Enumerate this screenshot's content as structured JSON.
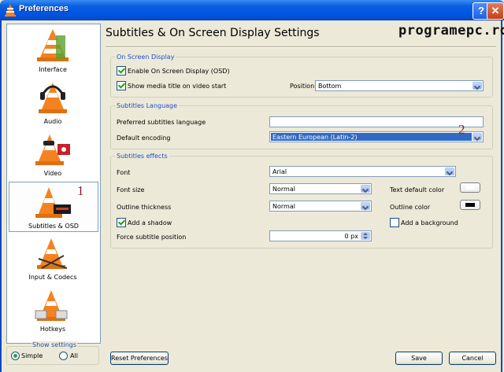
{
  "window": {
    "title": "Preferences",
    "help_glyph": "?",
    "close_glyph": "✕"
  },
  "sidebar": {
    "items": [
      {
        "label": "Interface"
      },
      {
        "label": "Audio"
      },
      {
        "label": "Video"
      },
      {
        "label": "Subtitles & OSD"
      },
      {
        "label": "Input & Codecs"
      },
      {
        "label": "Hotkeys"
      }
    ],
    "annotation": "1"
  },
  "show_settings": {
    "legend": "Show settings",
    "simple": "Simple",
    "all": "All",
    "selected": "Simple"
  },
  "header": {
    "title": "Subtitles & On Screen Display Settings",
    "brand": "programepc.ro"
  },
  "osd": {
    "legend": "On Screen Display",
    "enable_label": "Enable On Screen Display (OSD)",
    "show_title_label": "Show media title on video start",
    "position_label": "Position",
    "position_value": "Bottom"
  },
  "lang": {
    "legend": "Subtitles Language",
    "preferred_label": "Preferred subtitles language",
    "preferred_value": "",
    "encoding_label": "Default encoding",
    "encoding_value": "Eastern European (Latin-2)",
    "annotation": "2"
  },
  "effects": {
    "legend": "Subtitles effects",
    "font_label": "Font",
    "font_value": "Arial",
    "size_label": "Font size",
    "size_value": "Normal",
    "thickness_label": "Outline thickness",
    "thickness_value": "Normal",
    "text_color_label": "Text default color",
    "outline_color_label": "Outline color",
    "shadow_label": "Add a shadow",
    "background_label": "Add a background",
    "force_pos_label": "Force subtitle position",
    "force_pos_value": "0 px",
    "text_color": "#ffffff",
    "outline_color": "#000000"
  },
  "buttons": {
    "reset": "Reset Preferences",
    "save": "Save",
    "cancel": "Cancel"
  }
}
